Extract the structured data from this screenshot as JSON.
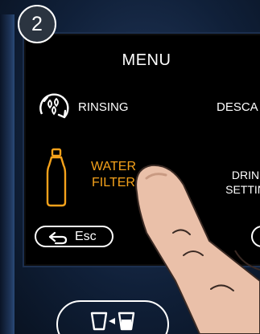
{
  "step_badge": "2",
  "menu": {
    "title": "MENU",
    "items": [
      {
        "label": "RINSING",
        "icon": "rinsing-icon",
        "state": "normal"
      },
      {
        "label": "DESCA",
        "state": "normal"
      },
      {
        "label_line1": "WATER",
        "label_line2": "FILTER",
        "icon": "water-filter-icon",
        "state": "selected"
      },
      {
        "label_line1": "DRIN",
        "label_line2": "SETTIN",
        "state": "normal"
      }
    ],
    "esc_label": "Esc"
  },
  "colors": {
    "selected": "#f5a21b",
    "screen_bg": "#000000",
    "text": "#ffffff",
    "device_body": "#1a2d4d"
  }
}
